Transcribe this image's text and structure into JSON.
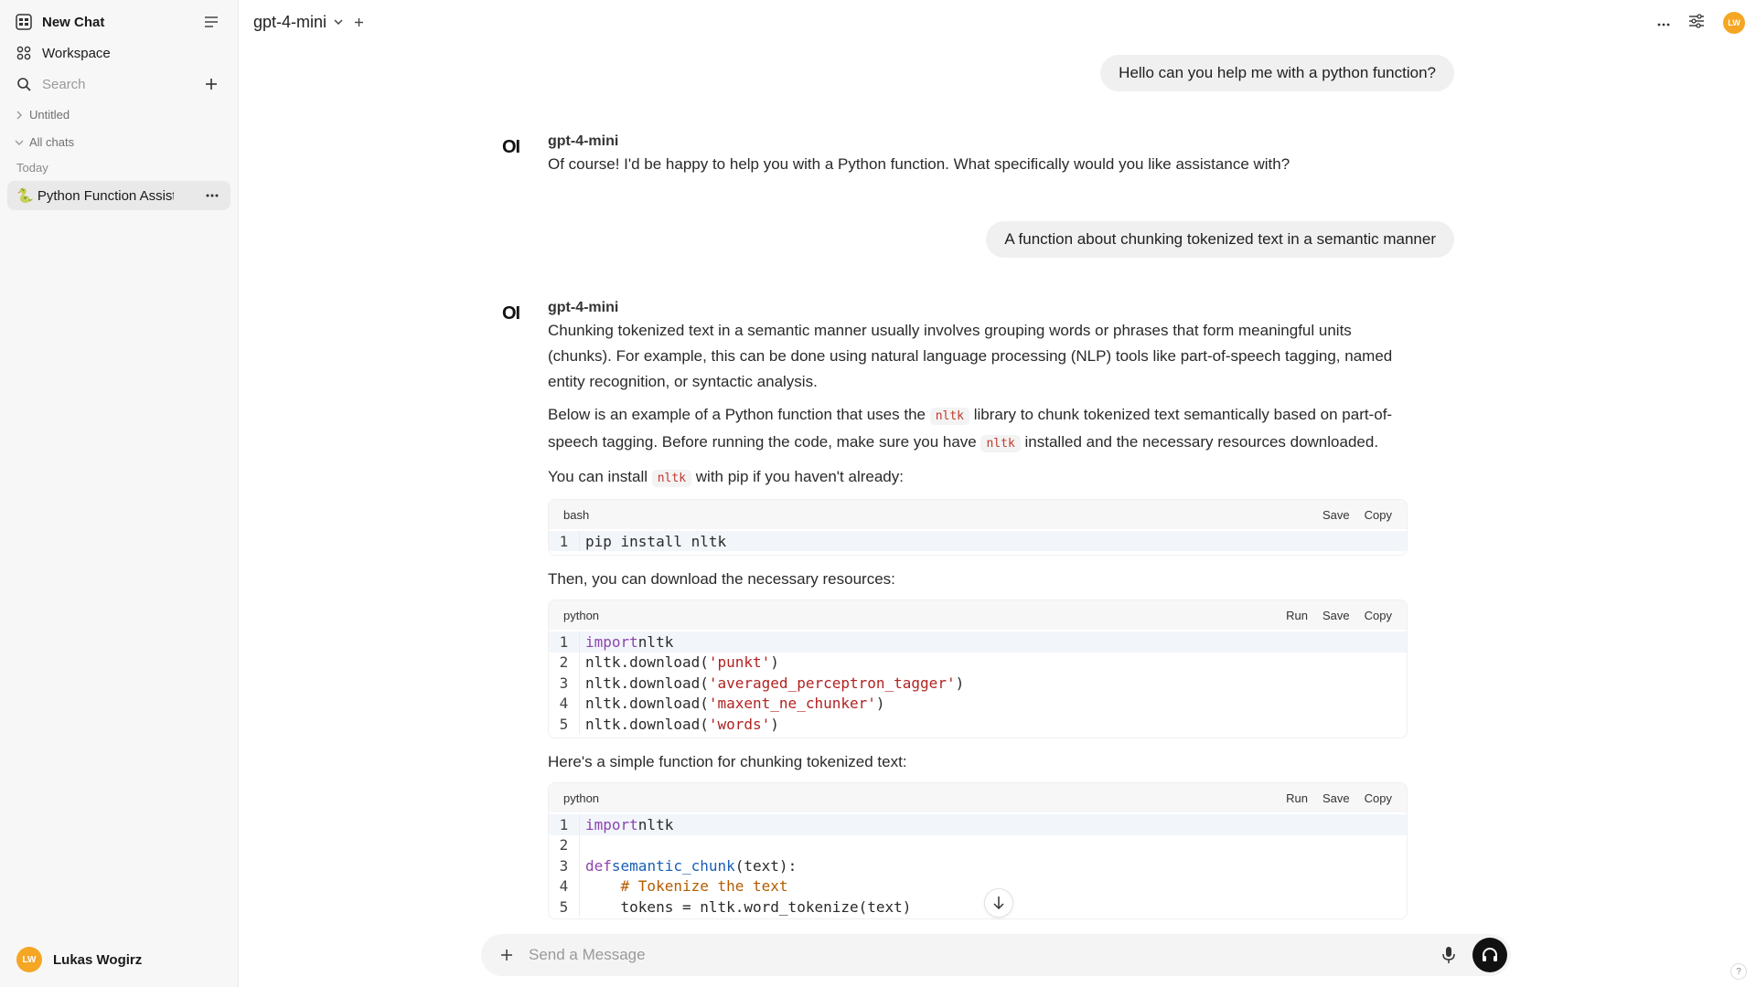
{
  "sidebar": {
    "new_chat": "New Chat",
    "workspace": "Workspace",
    "search_placeholder": "Search",
    "folders": [
      {
        "label": "Untitled"
      },
      {
        "label": "All chats"
      }
    ],
    "today_label": "Today",
    "chats": [
      {
        "emoji": "🐍",
        "title": "Python Function Assistance"
      }
    ],
    "user": {
      "initials": "LW",
      "name": "Lukas Wogirz"
    }
  },
  "header": {
    "model": "gpt-4-mini",
    "user_initials": "LW"
  },
  "messages": [
    {
      "role": "user",
      "text": "Hello can you help me with a python function?"
    },
    {
      "role": "assistant",
      "logo": "OI",
      "model": "gpt-4-mini",
      "text": "Of course! I'd be happy to help you with a Python function. What specifically would you like assistance with?"
    },
    {
      "role": "user",
      "text": "A function about chunking tokenized text in a semantic manner"
    },
    {
      "role": "assistant",
      "logo": "OI",
      "model": "gpt-4-mini",
      "p1": "Chunking tokenized text in a semantic manner usually involves grouping words or phrases that form meaningful units (chunks). For example, this can be done using natural language processing (NLP) tools like part-of-speech tagging, named entity recognition, or syntactic analysis.",
      "p2_a": "Below is an example of a Python function that uses the ",
      "p2_code1": "nltk",
      "p2_b": " library to chunk tokenized text semantically based on part-of-speech tagging. Before running the code, make sure you have ",
      "p2_code2": "nltk",
      "p2_c": " installed and the necessary resources downloaded.",
      "p3_a": "You can install ",
      "p3_code": "nltk",
      "p3_b": " with pip if you haven't already:",
      "code1": {
        "lang": "bash",
        "save": "Save",
        "copy": "Copy",
        "lines": [
          "pip install nltk"
        ]
      },
      "p4": "Then, you can download the necessary resources:",
      "code2": {
        "lang": "python",
        "run": "Run",
        "save": "Save",
        "copy": "Copy"
      },
      "p5": "Here's a simple function for chunking tokenized text:",
      "code3": {
        "lang": "python",
        "run": "Run",
        "save": "Save",
        "copy": "Copy"
      }
    }
  ],
  "code2_lines": [
    {
      "n": "1",
      "a": "import",
      "b": " nltk",
      "c": "",
      "d": ""
    },
    {
      "n": "2",
      "a": "",
      "b": "nltk.download(",
      "c": "'punkt'",
      "d": ")"
    },
    {
      "n": "3",
      "a": "",
      "b": "nltk.download(",
      "c": "'averaged_perceptron_tagger'",
      "d": ")"
    },
    {
      "n": "4",
      "a": "",
      "b": "nltk.download(",
      "c": "'maxent_ne_chunker'",
      "d": ")"
    },
    {
      "n": "5",
      "a": "",
      "b": "nltk.download(",
      "c": "'words'",
      "d": ")"
    }
  ],
  "code3_lines": [
    {
      "n": "1",
      "kw": "import",
      "rest": " nltk"
    },
    {
      "n": "2",
      "kw": "",
      "rest": ""
    },
    {
      "n": "3",
      "kw": "def",
      "fn": " semantic_chunk",
      "rest": "(text):"
    },
    {
      "n": "4",
      "cm": "    # Tokenize the text"
    },
    {
      "n": "5",
      "rest": "    tokens = nltk.word_tokenize(text)"
    }
  ],
  "composer": {
    "placeholder": "Send a Message"
  },
  "help": "?",
  "colors": {
    "accent_avatar": "#f5a623",
    "code_keyword": "#8e44ad",
    "code_string": "#b22222",
    "code_function": "#1a5fb4",
    "code_comment": "#b35c00"
  }
}
